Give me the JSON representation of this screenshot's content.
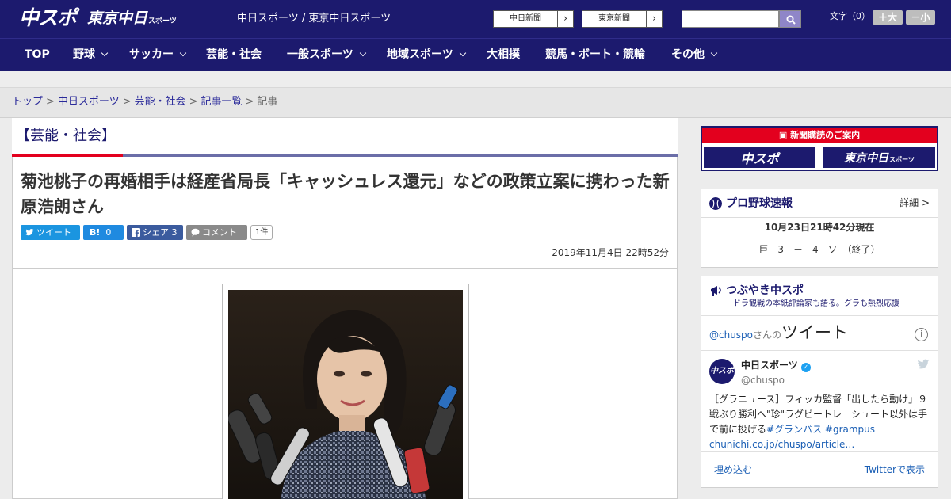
{
  "header": {
    "logo_chuspo": "中スポ",
    "logo_tokyo": "東京中日",
    "logo_tokyo_sub": "スポーツ",
    "site_links": "中日スポーツ / 東京中日スポーツ",
    "chunichi_shinbun": "中日新聞",
    "tokyo_shinbun": "東京新聞",
    "arrow": "›",
    "search_placeholder": "",
    "font_size_label": "文字（0）",
    "font_larger": "＋大",
    "font_smaller": "－小"
  },
  "nav": {
    "items": [
      {
        "label": "TOP"
      },
      {
        "label": "野球"
      },
      {
        "label": "サッカー"
      },
      {
        "label": "芸能・社会"
      },
      {
        "label": "一般スポーツ"
      },
      {
        "label": "地域スポーツ"
      },
      {
        "label": "大相撲"
      },
      {
        "label": "競馬・ボート・競輪"
      },
      {
        "label": "その他"
      }
    ]
  },
  "breadcrumb": {
    "items": [
      "トップ",
      "中日スポーツ",
      "芸能・社会",
      "記事一覧"
    ],
    "separator": ">",
    "current": "記事"
  },
  "article": {
    "category": "【芸能・社会】",
    "headline": "菊池桃子の再婚相手は経産省局長「キャッシュレス還元」などの政策立案に携わった新原浩朗さん",
    "share": {
      "tweet": "ツイート",
      "hatena_icon": "B!",
      "hatena_count": "0",
      "facebook": "シェア",
      "facebook_count": "3",
      "comment": "コメント",
      "comment_count": "1件"
    },
    "date": "2019年11月4日 22時52分"
  },
  "sidebar": {
    "ad": {
      "title": "新聞購読のご案内",
      "left": "中スポ",
      "right": "東京中日",
      "right_sub": "スポーツ"
    },
    "baseball": {
      "title": "プロ野球速報",
      "detail": "詳細 >",
      "time": "10月23日21時42分現在",
      "score": "巨　3　－　4　ソ　（終了）"
    },
    "tweets": {
      "title": "つぶやき中スポ",
      "subtitle": "ドラ観戦の本紙評論家も語る。グラも熱烈応援",
      "handle": "@chuspo",
      "handle_suffix": "さんの",
      "tweet_word": "ツイート",
      "info": "i",
      "avatar_text": "中スポ",
      "account_name": "中日スポーツ",
      "verified": "✓",
      "screen_name": "@chuspo",
      "body_text": "［グラニュース］フィッカ監督「出したら動け」９戦ぶり勝利へ\"珍\"ラグビートレ　シュート以外は手で前に投げる",
      "tag1": "#グランパス",
      "tag2": "#grampus",
      "link": "chunichi.co.jp/chuspo/article…",
      "embed": "埋め込む",
      "view_on_twitter": "Twitterで表示"
    }
  }
}
